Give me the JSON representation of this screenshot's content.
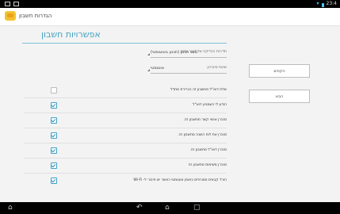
{
  "statusbar": {
    "time": "23:4"
  },
  "actionbar": {
    "title": "הגדרות חשבון"
  },
  "heading": "אפשרויות חשבון",
  "fields": [
    {
      "value": "מצב תכנון (תכנון באוטומטי)",
      "label": "תדירות הבדיקה של דואר נכנס"
    },
    {
      "value": "אוטומטי",
      "label": "שיטת סינכרון"
    }
  ],
  "options": [
    {
      "text": "שלח דוא\"ל מחשבון זה כברירת מחדל",
      "checked": false
    },
    {
      "text": "הודע לי כשמגיע דוא\"ל",
      "checked": true
    },
    {
      "text": "סנכרן אנשי קשר מחשבון זה.",
      "checked": true
    },
    {
      "text": "סנכרן את לוח השנה מחשבון זה.",
      "checked": true
    },
    {
      "text": "סנכרן דוא\"ל מחשבון זה.",
      "checked": true
    },
    {
      "text": "סנכרן משימות מחשבון זה",
      "checked": true
    },
    {
      "text": "הורד קבצים מצורפים באופן אוטומטי כאשר יש חיבור ל- Wi-Fi",
      "checked": true
    }
  ],
  "buttons": {
    "prev": "הקודם",
    "next": "הבא"
  }
}
